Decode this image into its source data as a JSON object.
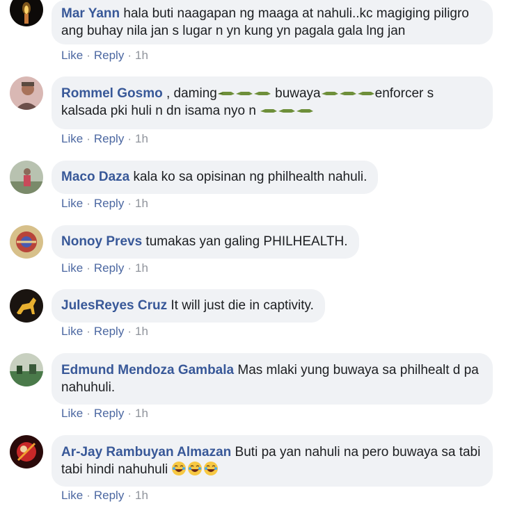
{
  "comments": [
    {
      "author": "Mar Yann",
      "text": " hala buti naagapan ng maaga at nahuli..kc magiging piligro ang buhay nila jan s lugar n yn kung yn pagala gala lng jan",
      "like": "Like",
      "reply": "Reply",
      "time": "1h",
      "avatar_icon": "candle-avatar-icon"
    },
    {
      "author": "Rommel Gosmo",
      "text_parts": [
        " , daming",
        " buwaya",
        "enforcer s kalsada pki huli n dn isama nyo n "
      ],
      "like": "Like",
      "reply": "Reply",
      "time": "1h",
      "avatar_icon": "person-avatar-icon"
    },
    {
      "author": "Maco Daza",
      "text": " kala ko sa opisinan ng philhealth nahuli.",
      "like": "Like",
      "reply": "Reply",
      "time": "1h",
      "avatar_icon": "person-outdoor-avatar-icon"
    },
    {
      "author": "Nonoy Prevs",
      "text": " tumakas yan galing PHILHEALTH.",
      "like": "Like",
      "reply": "Reply",
      "time": "1h",
      "avatar_icon": "emblem-avatar-icon"
    },
    {
      "author": "JulesReyes Cruz",
      "text": " It will just die in captivity.",
      "like": "Like",
      "reply": "Reply",
      "time": "1h",
      "avatar_icon": "gold-horse-avatar-icon"
    },
    {
      "author": "Edmund Mendoza Gambala",
      "text": " Mas mlaki yung buwaya sa philhealt d pa nahuhuli.",
      "like": "Like",
      "reply": "Reply",
      "time": "1h",
      "avatar_icon": "landscape-avatar-icon"
    },
    {
      "author": "Ar-Jay Rambuyan Almazan",
      "text": " Buti pa yan nahuli na pero buwaya sa tabi tabi hindi nahuhuli ",
      "like": "Like",
      "reply": "Reply",
      "time": "1h",
      "avatar_icon": "red-graphic-avatar-icon"
    }
  ],
  "colors": {
    "author": "#385898",
    "bubble_bg": "#f0f2f5",
    "action_link": "#4b67a1",
    "meta": "#90949c"
  }
}
